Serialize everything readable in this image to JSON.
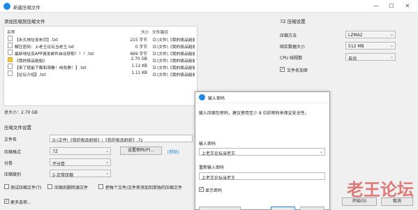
{
  "window": {
    "title": "新建压缩文件",
    "minimize": "—",
    "maximize": "☐",
    "close": "✕"
  },
  "files_section": {
    "title": "添加压缩到压缩文件"
  },
  "columns": {
    "name": "名称",
    "size": "大小",
    "path": "文件路径"
  },
  "files": [
    {
      "name": "【永久地址发布页】.txt",
      "size": "215 字节",
      "path": "D:\\文件\\《我的极品姐姐》\\【永久地址发布页】.txt",
      "icon": "file-icon"
    },
    {
      "name": "解压密码：上老王论坛当老王.txt",
      "size": "0 字节",
      "path": "D:\\文件\\《我的极品姐姐》\\解压密码：上老王论坛当老王.txt",
      "icon": "file-icon"
    },
    {
      "name": "最新地址及APP请发邮件自动获取！！！.txt",
      "size": "669 字节",
      "path": "D:\\文件\\《我的极品姐姐》\\最新地址及APP请发邮件自动获取！！！.txt",
      "icon": "file-icon"
    },
    {
      "name": "《我的极品姐姐》",
      "size": "2.70 GB",
      "path": "D:\\文件\\《我的极品姐姐》\\《我的极品姐姐》",
      "icon": "folder-icon"
    },
    {
      "name": "【来了就能下载和观看！纯免费！】.txt",
      "size": "1.12 KB",
      "path": "D:\\文件\\《我的极品姐姐》\\【来了就能下载和观看！纯免费！】.txt",
      "icon": "file-icon"
    },
    {
      "name": "【论坛介绍】.txt",
      "size": "1.11 KB",
      "path": "D:\\文件\\《我的极品姐姐》\\【论坛介绍】.txt",
      "icon": "file-icon"
    }
  ],
  "total_size": "总大小：2.70 GB",
  "archive_settings": {
    "title": "压缩文件设置",
    "filename_label": "文件名",
    "filename_value": "D:\\文件\\《我的极品姐姐》\\《我的极品姐姐》.7z",
    "format_label": "压缩格式",
    "format_value": "7Z",
    "set_password_button": "设置密码(P)...",
    "help_link": "[帮助]",
    "volume_label": "分卷",
    "volume_value": "不分卷",
    "level_label": "压缩级别",
    "level_value": "2-正常压缩",
    "test_archive": "测试压缩文件(T)",
    "delete_after": "压缩后删除源文件",
    "separate_each": "把每个文件/文件夹添加到单独的压缩文件",
    "more_options": "更多选项..."
  },
  "sevenz_settings": {
    "title": "7Z 压缩设置",
    "method_label": "压缩方法",
    "method_value": "LZMA2",
    "dict_label": "固实数据大小",
    "dict_value": "512 MB",
    "threads_label": "CPU 线程数",
    "threads_value": "自动",
    "encrypt_names": "文件名加密"
  },
  "password_dialog": {
    "title": "输入密码",
    "prompt": "输入压缩包密码，建议使用至少 8 位的密码来保证安全性。",
    "password_label": "输入密码",
    "password_value": "上老王论坛当老王",
    "reenter_label": "重新输入密码",
    "reenter_value": "上老王论坛当老王",
    "show_password": "显示密码"
  },
  "bottom_buttons": {
    "start": "开始(S)",
    "cancel": "取消"
  },
  "watermark": "老王论坛",
  "colors": {
    "accent": "#1e88e5",
    "watermark": "#d9534f",
    "folder": "#f5c542"
  }
}
